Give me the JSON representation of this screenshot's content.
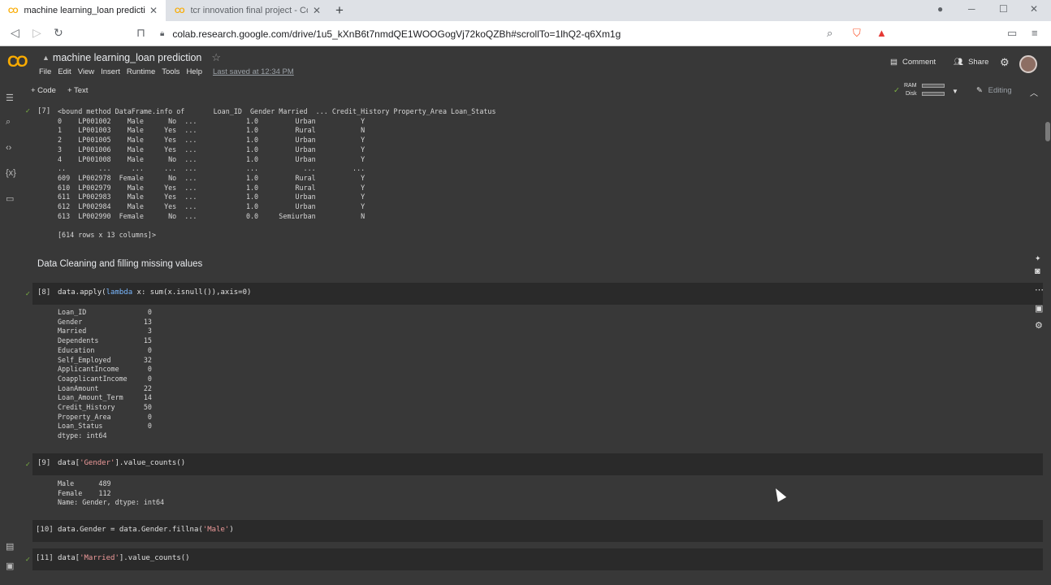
{
  "browser": {
    "tabs": [
      {
        "label": "machine learning_loan prediction",
        "icon": "colab-logo-icon"
      },
      {
        "label": "tcr innovation final project - Colabora",
        "icon": "colab-logo-icon"
      }
    ],
    "url": "colab.research.google.com/drive/1u5_kXnB6t7nmdQE1WOOGogVj72koQZBh#scrollTo=1lhQ2-q6Xm1g"
  },
  "colab": {
    "logo": "CO",
    "title": "machine learning_loan prediction",
    "menu": [
      "File",
      "Edit",
      "View",
      "Insert",
      "Runtime",
      "Tools",
      "Help"
    ],
    "last_saved": "Last saved at 12:34 PM",
    "comment_label": "Comment",
    "share_label": "Share",
    "add_code": "+ Code",
    "add_text": "+ Text",
    "ram_label": "RAM",
    "disk_label": "Disk",
    "editing_label": "Editing"
  },
  "cells": {
    "c7": {
      "number": "[7]",
      "output": "<bound method DataFrame.info of       Loan_ID  Gender Married  ... Credit_History Property_Area Loan_Status\n0    LP001002    Male      No  ...            1.0         Urban           Y\n1    LP001003    Male     Yes  ...            1.0         Rural           N\n2    LP001005    Male     Yes  ...            1.0         Urban           Y\n3    LP001006    Male     Yes  ...            1.0         Urban           Y\n4    LP001008    Male      No  ...            1.0         Urban           Y\n..        ...     ...     ...  ...            ...           ...         ...\n609  LP002978  Female      No  ...            1.0         Rural           Y\n610  LP002979    Male     Yes  ...            1.0         Rural           Y\n611  LP002983    Male     Yes  ...            1.0         Urban           Y\n612  LP002984    Male     Yes  ...            1.0         Urban           Y\n613  LP002990  Female      No  ...            0.0     Semiurban           N\n\n[614 rows x 13 columns]>"
    },
    "markdown": "Data Cleaning and filling missing values",
    "c8": {
      "number": "[8]",
      "code_a": "data.apply(",
      "code_kw": "lambda",
      "code_b": " x: sum(x.isnull()),axis=0)",
      "output": "Loan_ID               0\nGender               13\nMarried               3\nDependents           15\nEducation             0\nSelf_Employed        32\nApplicantIncome       0\nCoapplicantIncome     0\nLoanAmount           22\nLoan_Amount_Term     14\nCredit_History       50\nProperty_Area         0\nLoan_Status           0\ndtype: int64"
    },
    "c9": {
      "number": "[9]",
      "code_a": "data[",
      "code_str": "'Gender'",
      "code_b": "].value_counts()",
      "output": "Male      489\nFemale    112\nName: Gender, dtype: int64"
    },
    "c10": {
      "number": "[10]",
      "code_a": "data.Gender = data.Gender.fillna(",
      "code_str": "'Male'",
      "code_b": ")"
    },
    "c11": {
      "number": "[11]",
      "code_a": "data[",
      "code_str": "'Married'",
      "code_b": "].value_counts()"
    }
  }
}
